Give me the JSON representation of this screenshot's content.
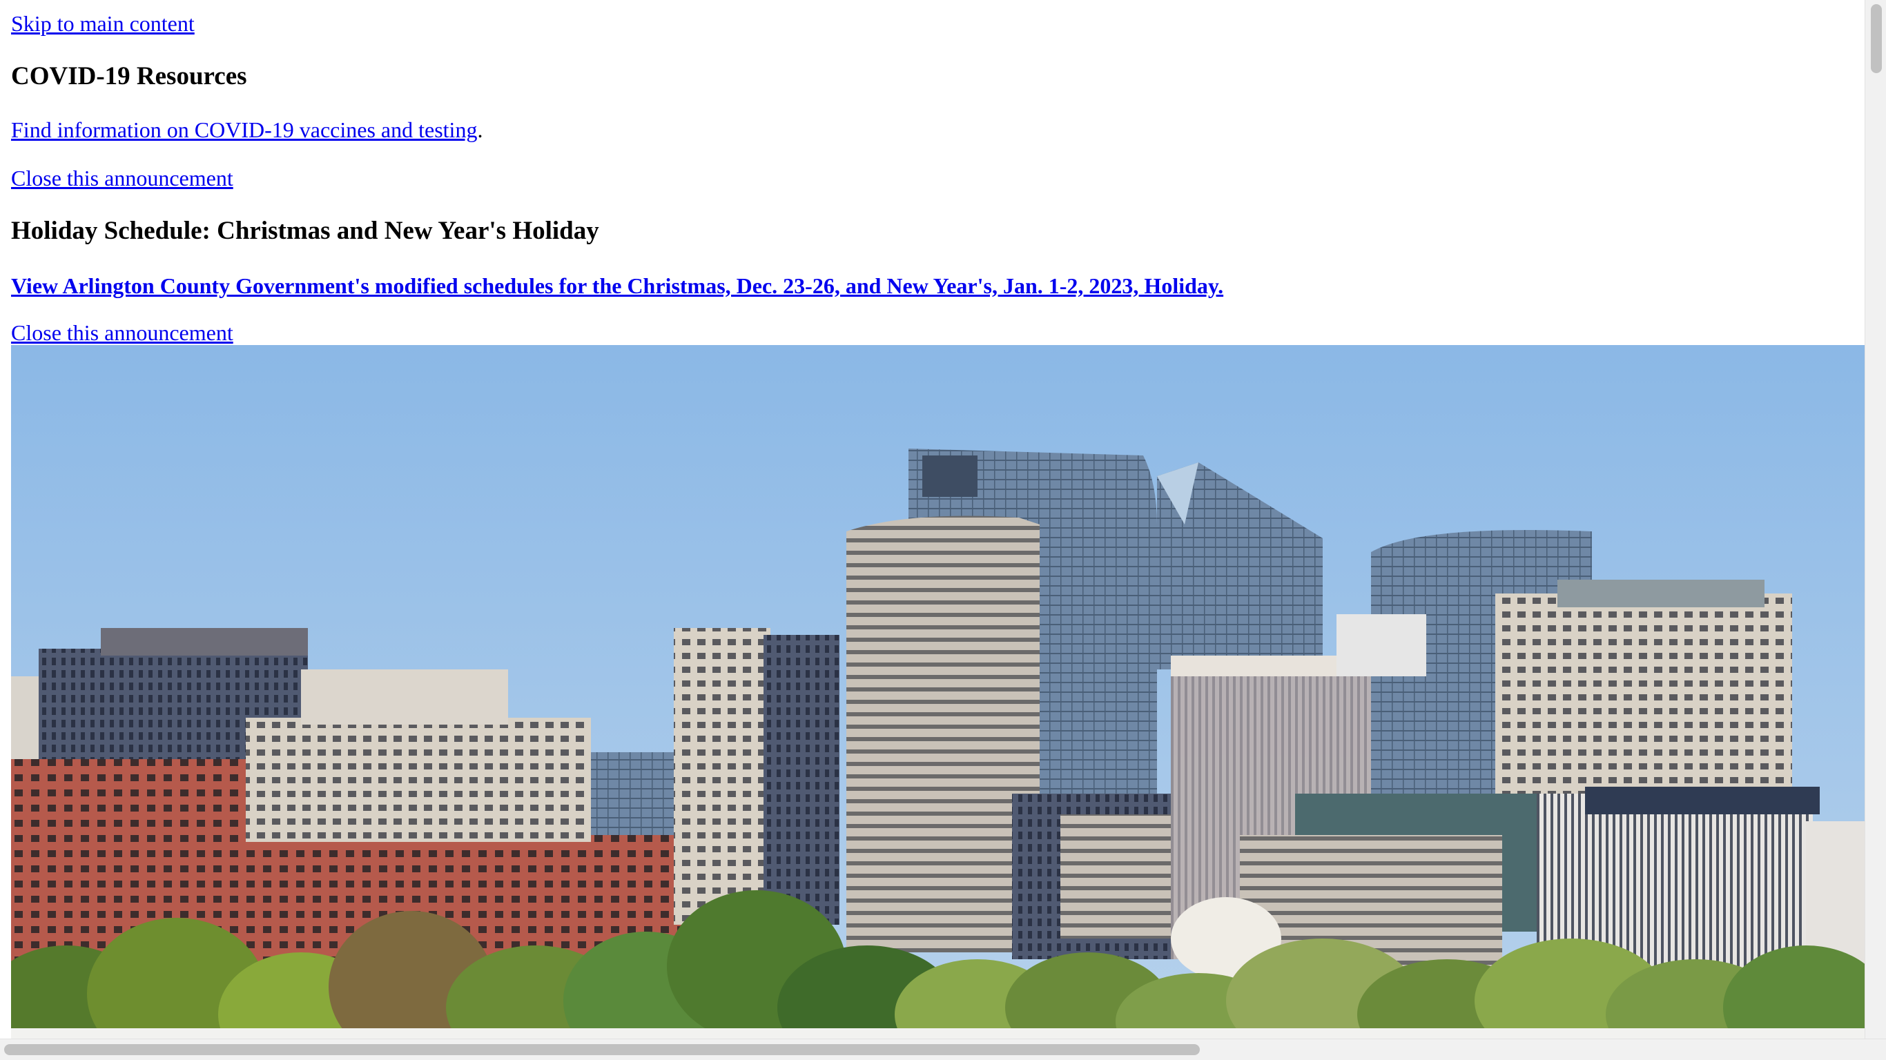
{
  "skip_link": "Skip to main content",
  "covid": {
    "heading": "COVID-19 Resources",
    "link_text": "Find information on COVID-19 vaccines and testing",
    "trailing": ".",
    "close": "Close this announcement"
  },
  "holiday": {
    "heading": "Holiday Schedule: Christmas and New Year's Holiday",
    "link_text": "View Arlington County Government's modified schedules for the Christmas, Dec. 23-26, and New Year's, Jan. 1-2, 2023, Holiday.",
    "close": "Close this announcement"
  },
  "colors": {
    "link": "#0000ee",
    "sky": "#8db9e4"
  }
}
